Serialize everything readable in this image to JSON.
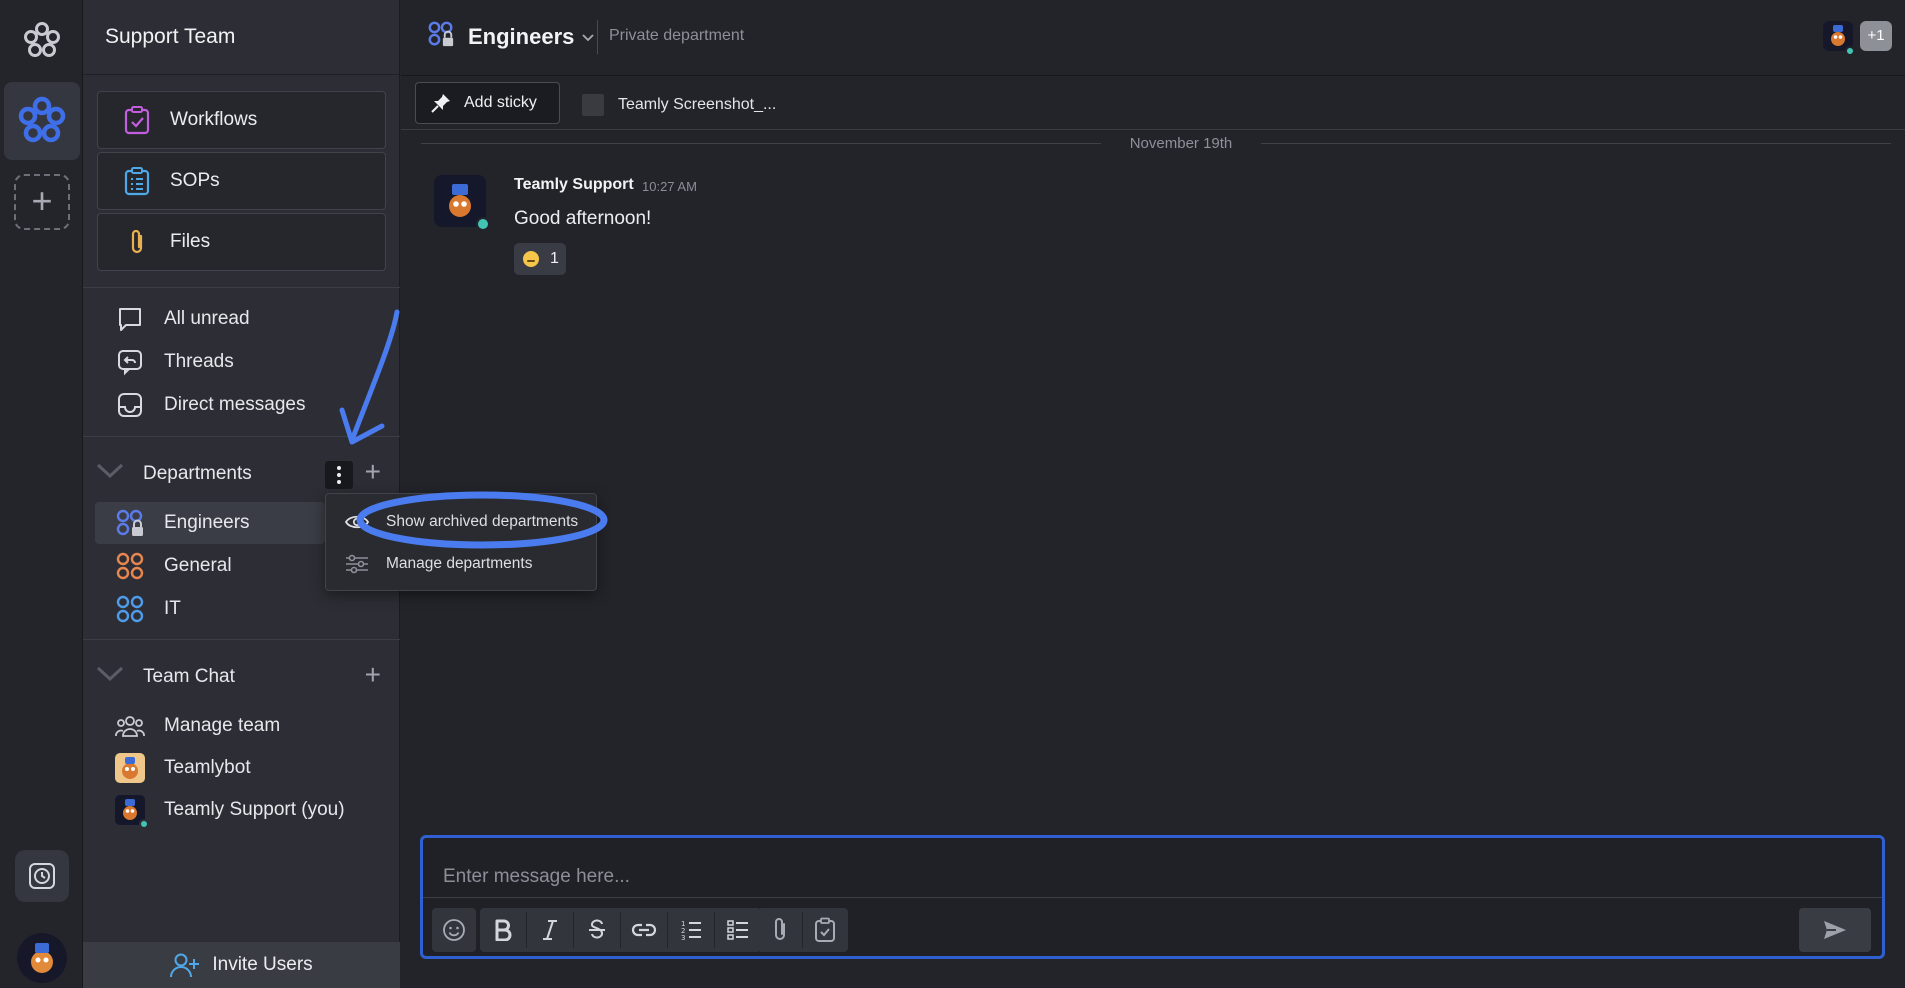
{
  "sidebar": {
    "workspace_name": "Support Team",
    "tools": [
      {
        "label": "Workflows",
        "icon": "workflows-icon"
      },
      {
        "label": "SOPs",
        "icon": "sops-icon"
      },
      {
        "label": "Files",
        "icon": "paperclip-icon"
      }
    ],
    "nav": [
      {
        "label": "All unread",
        "icon": "chat-bubble-icon"
      },
      {
        "label": "Threads",
        "icon": "threads-icon"
      },
      {
        "label": "Direct messages",
        "icon": "inbox-icon"
      }
    ],
    "departments": {
      "title": "Departments",
      "items": [
        {
          "label": "Engineers",
          "color": "#5b7be8",
          "locked": true
        },
        {
          "label": "General",
          "color": "#e8864f"
        },
        {
          "label": "IT",
          "color": "#4f9be8"
        }
      ]
    },
    "team_chat": {
      "title": "Team Chat",
      "items": [
        {
          "label": "Manage team",
          "icon": "team-icon"
        },
        {
          "label": "Teamlybot",
          "icon": "bot-avatar"
        },
        {
          "label": "Teamly Support (you)",
          "icon": "user-avatar"
        }
      ]
    },
    "invite_label": "Invite Users"
  },
  "dropdown": {
    "items": [
      {
        "label": "Show archived departments",
        "icon": "eye-icon"
      },
      {
        "label": "Manage departments",
        "icon": "sliders-icon"
      }
    ]
  },
  "header": {
    "channel_name": "Engineers",
    "channel_type": "Private department",
    "extra_members": "+1"
  },
  "pinbar": {
    "add_sticky_label": "Add sticky",
    "pinned_file": "Teamly Screenshot_..."
  },
  "messages": {
    "date_divider": "November 19th",
    "items": [
      {
        "author": "Teamly Support",
        "time": "10:27 AM",
        "text": "Good afternoon!",
        "reaction_count": "1"
      }
    ]
  },
  "composer": {
    "placeholder": "Enter message here..."
  },
  "colors": {
    "accent": "#2f5fd1",
    "annotation": "#4a7cf0",
    "online": "#42c4b4",
    "workflows": "#c45ee0",
    "sops": "#4fa8e8",
    "files": "#e8b04f"
  }
}
